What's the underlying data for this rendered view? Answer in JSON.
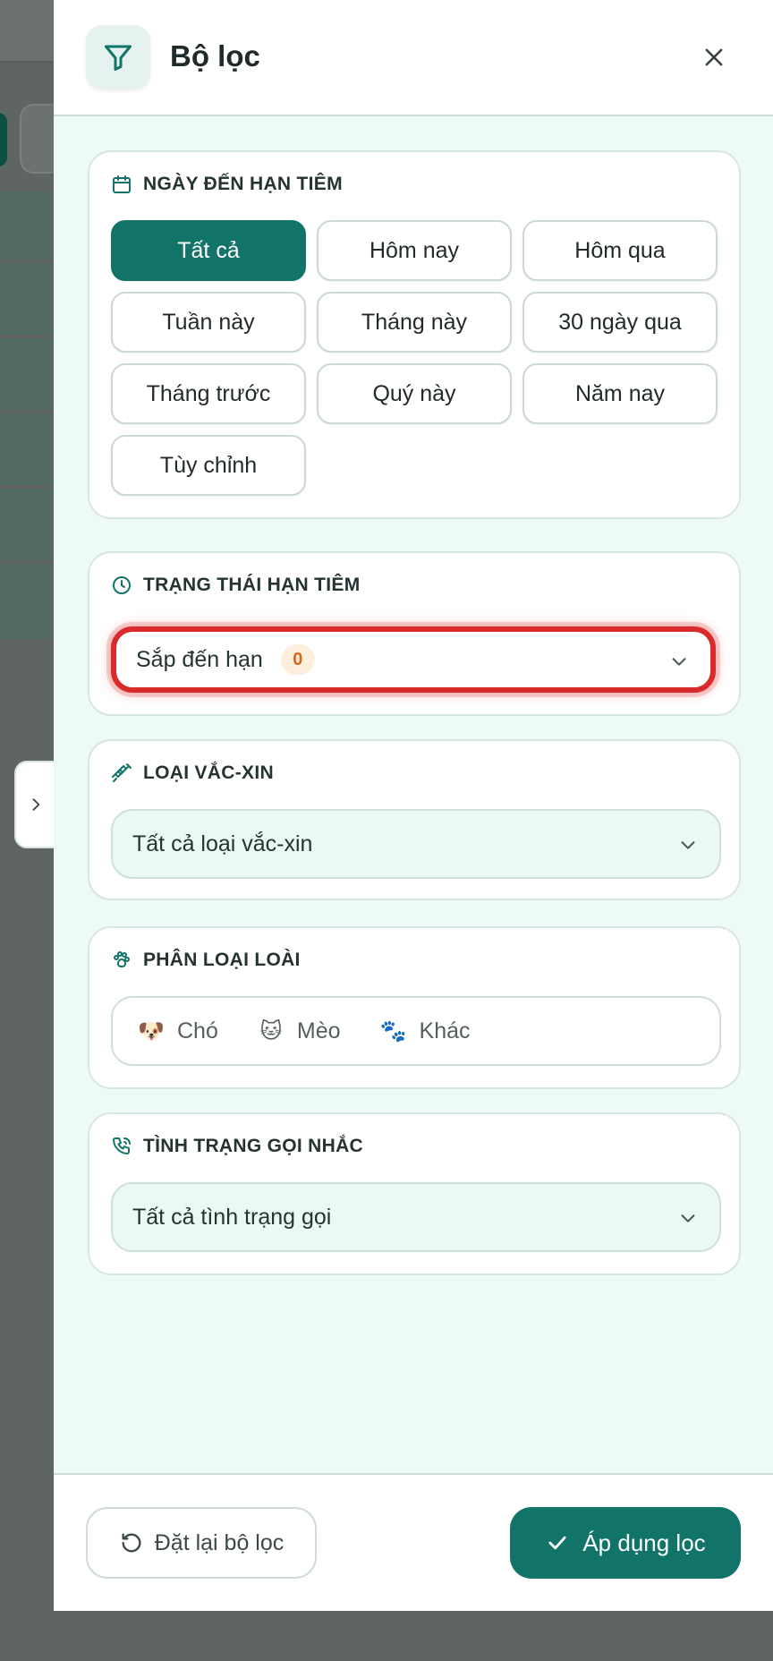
{
  "header": {
    "title": "Bộ lọc",
    "icon": "filter-icon"
  },
  "due_date": {
    "title": "NGÀY ĐẾN HẠN TIÊM",
    "icon": "calendar-icon",
    "chips": [
      "Tất cả",
      "Hôm nay",
      "Hôm qua",
      "Tuần này",
      "Tháng này",
      "30 ngày qua",
      "Tháng trước",
      "Quý này",
      "Năm nay",
      "Tùy chỉnh"
    ],
    "selected": "Tất cả"
  },
  "status": {
    "title": "TRẠNG THÁI HẠN TIÊM",
    "icon": "clock-icon",
    "selected": "Sắp đến hạn",
    "count": "0"
  },
  "vaccine": {
    "title": "LOẠI VẮC-XIN",
    "icon": "syringe-icon",
    "selected": "Tất cả loại vắc-xin"
  },
  "species": {
    "title": "PHÂN LOẠI LOÀI",
    "icon": "paw-icon",
    "items": [
      {
        "emoji": "🐶",
        "label": "Chó"
      },
      {
        "emoji": "🐱",
        "label": "Mèo"
      },
      {
        "emoji": "🐾",
        "label": "Khác"
      }
    ]
  },
  "call": {
    "title": "TÌNH TRẠNG GỌI NHẮC",
    "icon": "phone-icon",
    "selected": "Tất cả tình trạng gọi"
  },
  "footer": {
    "reset_label": "Đặt lại bộ lọc",
    "apply_label": "Áp dụng lọc"
  },
  "colors": {
    "primary": "#127468",
    "highlight_border": "#d92b2b",
    "badge_text": "#d8651a"
  }
}
